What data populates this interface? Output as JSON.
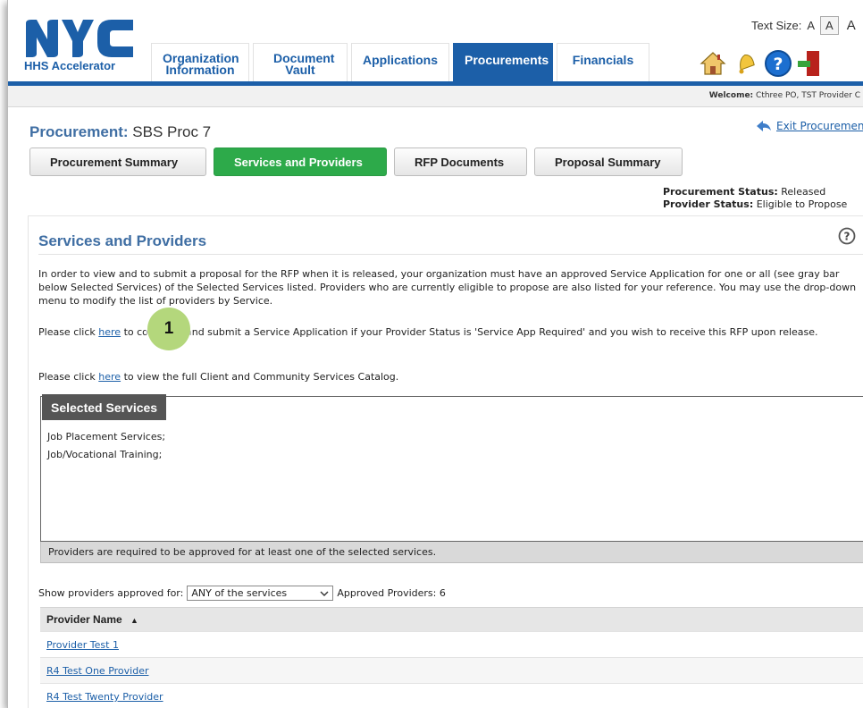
{
  "header": {
    "logo_text": "NYC",
    "logo_subtitle": "HHS Accelerator",
    "text_size_label": "Text Size:",
    "text_size_options": [
      "A",
      "A",
      "A"
    ],
    "nav_tabs": [
      {
        "label": "Organization Information",
        "active": false
      },
      {
        "label": "Document Vault",
        "active": false
      },
      {
        "label": "Applications",
        "active": false
      },
      {
        "label": "Procurements",
        "active": true
      },
      {
        "label": "Financials",
        "active": false
      }
    ],
    "icons": [
      "home-icon",
      "notification-bell-icon",
      "help-icon",
      "logout-icon"
    ],
    "welcome_label": "Welcome:",
    "welcome_user": "Cthree PO, TST Provider C",
    "accent": "#1c5fa8"
  },
  "procurement": {
    "title_label": "Procurement:",
    "title_value": "SBS Proc 7",
    "exit_label": "Exit Procurement",
    "subtabs": [
      {
        "label": "Procurement Summary",
        "active": false
      },
      {
        "label": "Services and Providers",
        "active": true
      },
      {
        "label": "RFP Documents",
        "active": false
      },
      {
        "label": "Proposal Summary",
        "active": false
      }
    ],
    "status_label": "Procurement Status:",
    "status_value": "Released",
    "provider_status_label": "Provider Status:",
    "provider_status_value": "Eligible to Propose"
  },
  "section": {
    "title": "Services and Providers",
    "intro": "In order to view and to submit a proposal for the RFP when it is released, your organization must have an approved Service Application for one or all (see gray bar below Selected Services) of the Selected Services listed. Providers who are currently eligible to propose are also listed for your reference. You may use the drop-down menu to modify the list of providers by Service.",
    "click1_pre": "Please click ",
    "click1_link": "here",
    "click1_post": " to complete and submit a Service Application if your Provider Status is 'Service App Required' and you wish to receive this RFP upon release.",
    "click2_pre": "Please click ",
    "click2_link": "here",
    "click2_post": " to view the full Client and Community Services Catalog.",
    "callout": "1",
    "selected_services_title": "Selected Services",
    "selected_services": [
      "Job Placement Services;",
      "Job/Vocational Training;"
    ],
    "requirement_note": "Providers are required to be approved for at least one of the selected services.",
    "filter_label": "Show providers approved for:",
    "filter_value": "ANY of the services",
    "approved_label": "Approved Providers: 6",
    "table_header": "Provider Name",
    "sort_glyph": "▲",
    "providers": [
      "Provider Test 1",
      "R4 Test One Provider",
      "R4 Test Twenty Provider"
    ]
  }
}
